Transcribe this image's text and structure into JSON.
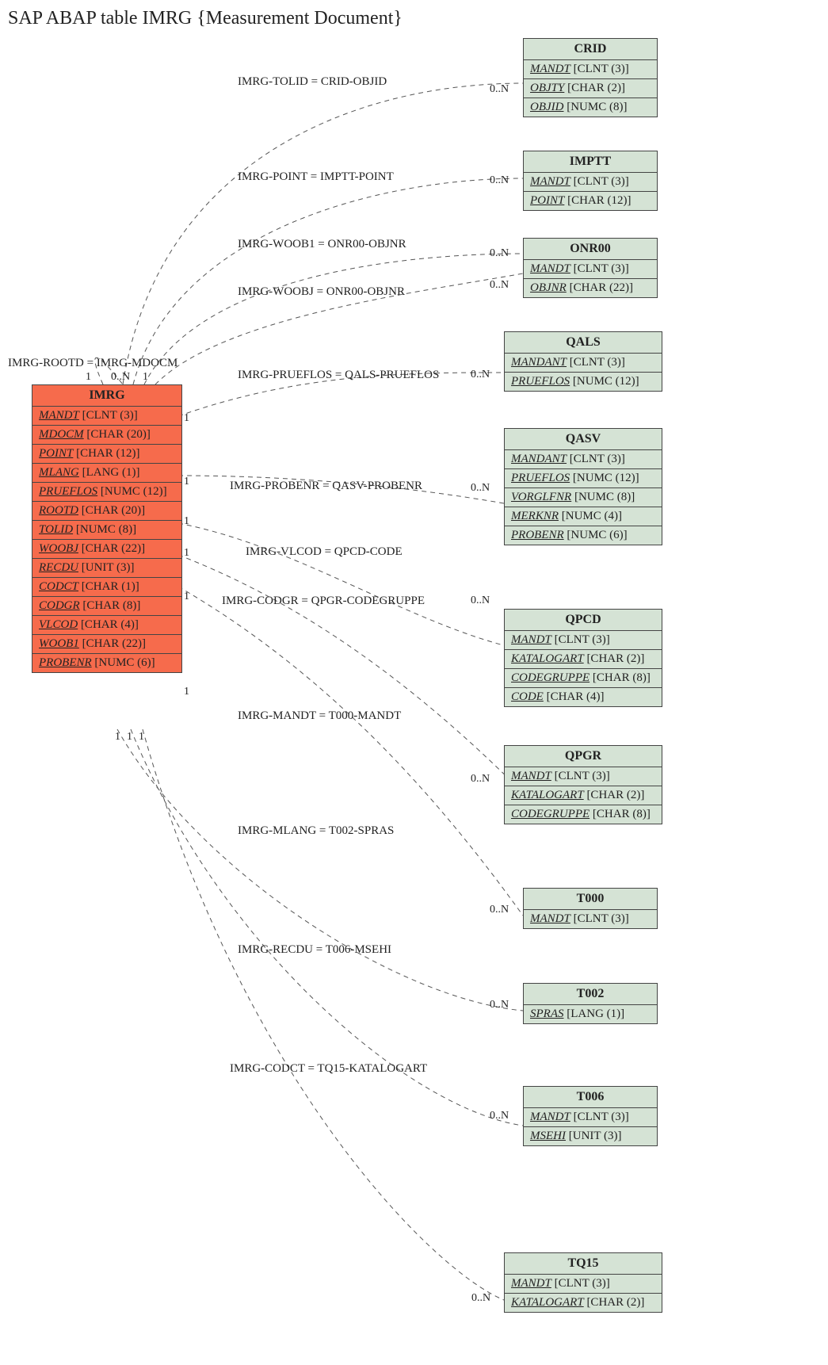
{
  "title": "SAP ABAP table IMRG {Measurement Document}",
  "main_table": {
    "name": "IMRG",
    "fields": [
      {
        "f": "MANDT",
        "t": "[CLNT (3)]"
      },
      {
        "f": "MDOCM",
        "t": "[CHAR (20)]"
      },
      {
        "f": "POINT",
        "t": "[CHAR (12)]"
      },
      {
        "f": "MLANG",
        "t": "[LANG (1)]"
      },
      {
        "f": "PRUEFLOS",
        "t": "[NUMC (12)]"
      },
      {
        "f": "ROOTD",
        "t": "[CHAR (20)]"
      },
      {
        "f": "TOLID",
        "t": "[NUMC (8)]"
      },
      {
        "f": "WOOBJ",
        "t": "[CHAR (22)]"
      },
      {
        "f": "RECDU",
        "t": "[UNIT (3)]"
      },
      {
        "f": "CODCT",
        "t": "[CHAR (1)]"
      },
      {
        "f": "CODGR",
        "t": "[CHAR (8)]"
      },
      {
        "f": "VLCOD",
        "t": "[CHAR (4)]"
      },
      {
        "f": "WOOB1",
        "t": "[CHAR (22)]"
      },
      {
        "f": "PROBENR",
        "t": "[NUMC (6)]"
      }
    ]
  },
  "related": [
    {
      "name": "CRID",
      "fields": [
        {
          "f": "MANDT",
          "t": "[CLNT (3)]"
        },
        {
          "f": "OBJTY",
          "t": "[CHAR (2)]"
        },
        {
          "f": "OBJID",
          "t": "[NUMC (8)]"
        }
      ]
    },
    {
      "name": "IMPTT",
      "fields": [
        {
          "f": "MANDT",
          "t": "[CLNT (3)]"
        },
        {
          "f": "POINT",
          "t": "[CHAR (12)]"
        }
      ]
    },
    {
      "name": "ONR00",
      "fields": [
        {
          "f": "MANDT",
          "t": "[CLNT (3)]"
        },
        {
          "f": "OBJNR",
          "t": "[CHAR (22)]"
        }
      ]
    },
    {
      "name": "QALS",
      "fields": [
        {
          "f": "MANDANT",
          "t": "[CLNT (3)]"
        },
        {
          "f": "PRUEFLOS",
          "t": "[NUMC (12)]"
        }
      ]
    },
    {
      "name": "QASV",
      "fields": [
        {
          "f": "MANDANT",
          "t": "[CLNT (3)]"
        },
        {
          "f": "PRUEFLOS",
          "t": "[NUMC (12)]"
        },
        {
          "f": "VORGLFNR",
          "t": "[NUMC (8)]"
        },
        {
          "f": "MERKNR",
          "t": "[NUMC (4)]"
        },
        {
          "f": "PROBENR",
          "t": "[NUMC (6)]"
        }
      ]
    },
    {
      "name": "QPCD",
      "fields": [
        {
          "f": "MANDT",
          "t": "[CLNT (3)]"
        },
        {
          "f": "KATALOGART",
          "t": "[CHAR (2)]"
        },
        {
          "f": "CODEGRUPPE",
          "t": "[CHAR (8)]"
        },
        {
          "f": "CODE",
          "t": "[CHAR (4)]"
        }
      ]
    },
    {
      "name": "QPGR",
      "fields": [
        {
          "f": "MANDT",
          "t": "[CLNT (3)]"
        },
        {
          "f": "KATALOGART",
          "t": "[CHAR (2)]"
        },
        {
          "f": "CODEGRUPPE",
          "t": "[CHAR (8)]"
        }
      ]
    },
    {
      "name": "T000",
      "fields": [
        {
          "f": "MANDT",
          "t": "[CLNT (3)]"
        }
      ]
    },
    {
      "name": "T002",
      "fields": [
        {
          "f": "SPRAS",
          "t": "[LANG (1)]"
        }
      ]
    },
    {
      "name": "T006",
      "fields": [
        {
          "f": "MANDT",
          "t": "[CLNT (3)]"
        },
        {
          "f": "MSEHI",
          "t": "[UNIT (3)]"
        }
      ]
    },
    {
      "name": "TQ15",
      "fields": [
        {
          "f": "MANDT",
          "t": "[CLNT (3)]"
        },
        {
          "f": "KATALOGART",
          "t": "[CHAR (2)]"
        }
      ]
    }
  ],
  "relations": [
    {
      "text": "IMRG-TOLID = CRID-OBJID",
      "card_l": "1",
      "card_r": "0..N"
    },
    {
      "text": "IMRG-POINT = IMPTT-POINT",
      "card_l": "1",
      "card_r": "0..N"
    },
    {
      "text": "IMRG-WOOB1 = ONR00-OBJNR",
      "card_l": "1",
      "card_r": "0..N"
    },
    {
      "text": "IMRG-WOOBJ = ONR00-OBJNR",
      "card_l": "1",
      "card_r": "0..N"
    },
    {
      "text": "IMRG-PRUEFLOS = QALS-PRUEFLOS",
      "card_l": "1",
      "card_r": "0..N"
    },
    {
      "text": "IMRG-PROBENR = QASV-PROBENR",
      "card_l": "1",
      "card_r": "0..N"
    },
    {
      "text": "IMRG-VLCOD = QPCD-CODE",
      "card_l": "1",
      "card_r": ""
    },
    {
      "text": "IMRG-CODGR = QPGR-CODEGRUPPE",
      "card_l": "1",
      "card_r": "0..N"
    },
    {
      "text": "IMRG-MANDT = T000-MANDT",
      "card_l": "1",
      "card_r": "0..N"
    },
    {
      "text": "IMRG-MLANG = T002-SPRAS",
      "card_l": "1",
      "card_r": "0..N"
    },
    {
      "text": "IMRG-RECDU = T006-MSEHI",
      "card_l": "1",
      "card_r": "0..N"
    },
    {
      "text": "IMRG-CODCT = TQ15-KATALOGART",
      "card_l": "1",
      "card_r": "0..N"
    }
  ],
  "self_rel": {
    "text": "IMRG-ROOTD = IMRG-MDOCM",
    "card_l": "1",
    "card_r": "0..N"
  },
  "chart_data": {
    "type": "table",
    "description": "Entity-relationship diagram for SAP ABAP table IMRG",
    "main_entity": "IMRG",
    "relationships": [
      {
        "from": "IMRG",
        "to": "CRID",
        "join": "IMRG-TOLID = CRID-OBJID",
        "cardinality": "1 : 0..N"
      },
      {
        "from": "IMRG",
        "to": "IMPTT",
        "join": "IMRG-POINT = IMPTT-POINT",
        "cardinality": "1 : 0..N"
      },
      {
        "from": "IMRG",
        "to": "ONR00",
        "join": "IMRG-WOOB1 = ONR00-OBJNR",
        "cardinality": "1 : 0..N"
      },
      {
        "from": "IMRG",
        "to": "ONR00",
        "join": "IMRG-WOOBJ = ONR00-OBJNR",
        "cardinality": "1 : 0..N"
      },
      {
        "from": "IMRG",
        "to": "QALS",
        "join": "IMRG-PRUEFLOS = QALS-PRUEFLOS",
        "cardinality": "1 : 0..N"
      },
      {
        "from": "IMRG",
        "to": "QASV",
        "join": "IMRG-PROBENR = QASV-PROBENR",
        "cardinality": "1 : 0..N"
      },
      {
        "from": "IMRG",
        "to": "QPCD",
        "join": "IMRG-VLCOD = QPCD-CODE",
        "cardinality": "1 : 0..N"
      },
      {
        "from": "IMRG",
        "to": "QPGR",
        "join": "IMRG-CODGR = QPGR-CODEGRUPPE",
        "cardinality": "1 : 0..N"
      },
      {
        "from": "IMRG",
        "to": "T000",
        "join": "IMRG-MANDT = T000-MANDT",
        "cardinality": "1 : 0..N"
      },
      {
        "from": "IMRG",
        "to": "T002",
        "join": "IMRG-MLANG = T002-SPRAS",
        "cardinality": "1 : 0..N"
      },
      {
        "from": "IMRG",
        "to": "T006",
        "join": "IMRG-RECDU = T006-MSEHI",
        "cardinality": "1 : 0..N"
      },
      {
        "from": "IMRG",
        "to": "TQ15",
        "join": "IMRG-CODCT = TQ15-KATALOGART",
        "cardinality": "1 : 0..N"
      },
      {
        "from": "IMRG",
        "to": "IMRG",
        "join": "IMRG-ROOTD = IMRG-MDOCM",
        "cardinality": "1 : 0..N"
      }
    ]
  }
}
